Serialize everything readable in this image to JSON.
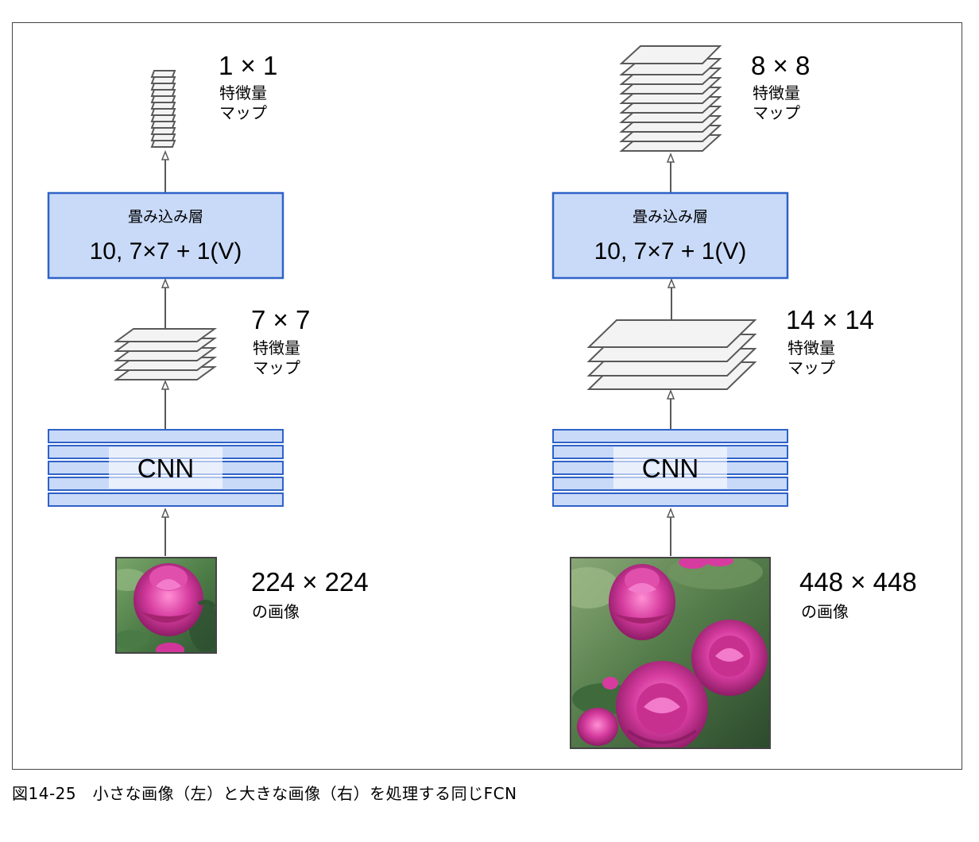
{
  "left": {
    "top_map": {
      "size": "1 × 1",
      "label_line1": "特徴量",
      "label_line2": "マップ"
    },
    "conv": {
      "title": "畳み込み層",
      "formula": "10, 7×7 + 1(V)"
    },
    "mid_map": {
      "size": "7 × 7",
      "label_line1": "特徴量",
      "label_line2": "マップ"
    },
    "cnn": {
      "label": "CNN"
    },
    "image": {
      "size": "224 × 224",
      "label": "の画像"
    }
  },
  "right": {
    "top_map": {
      "size": "8 × 8",
      "label_line1": "特徴量",
      "label_line2": "マップ"
    },
    "conv": {
      "title": "畳み込み層",
      "formula": "10, 7×7 + 1(V)"
    },
    "mid_map": {
      "size": "14 × 14",
      "label_line1": "特徴量",
      "label_line2": "マップ"
    },
    "cnn": {
      "label": "CNN"
    },
    "image": {
      "size": "448 × 448",
      "label": "の画像"
    }
  },
  "caption": "図14-25　小さな画像（左）と大きな画像（右）を処理する同じFCN",
  "colors": {
    "box_fill": "#c9daf8",
    "box_stroke": "#2f62c8",
    "layer_fill": "#f3f3f3",
    "layer_stroke": "#595959",
    "arrow": "#595959",
    "rose": "#d2359a",
    "foliage": "#5c8c52"
  }
}
